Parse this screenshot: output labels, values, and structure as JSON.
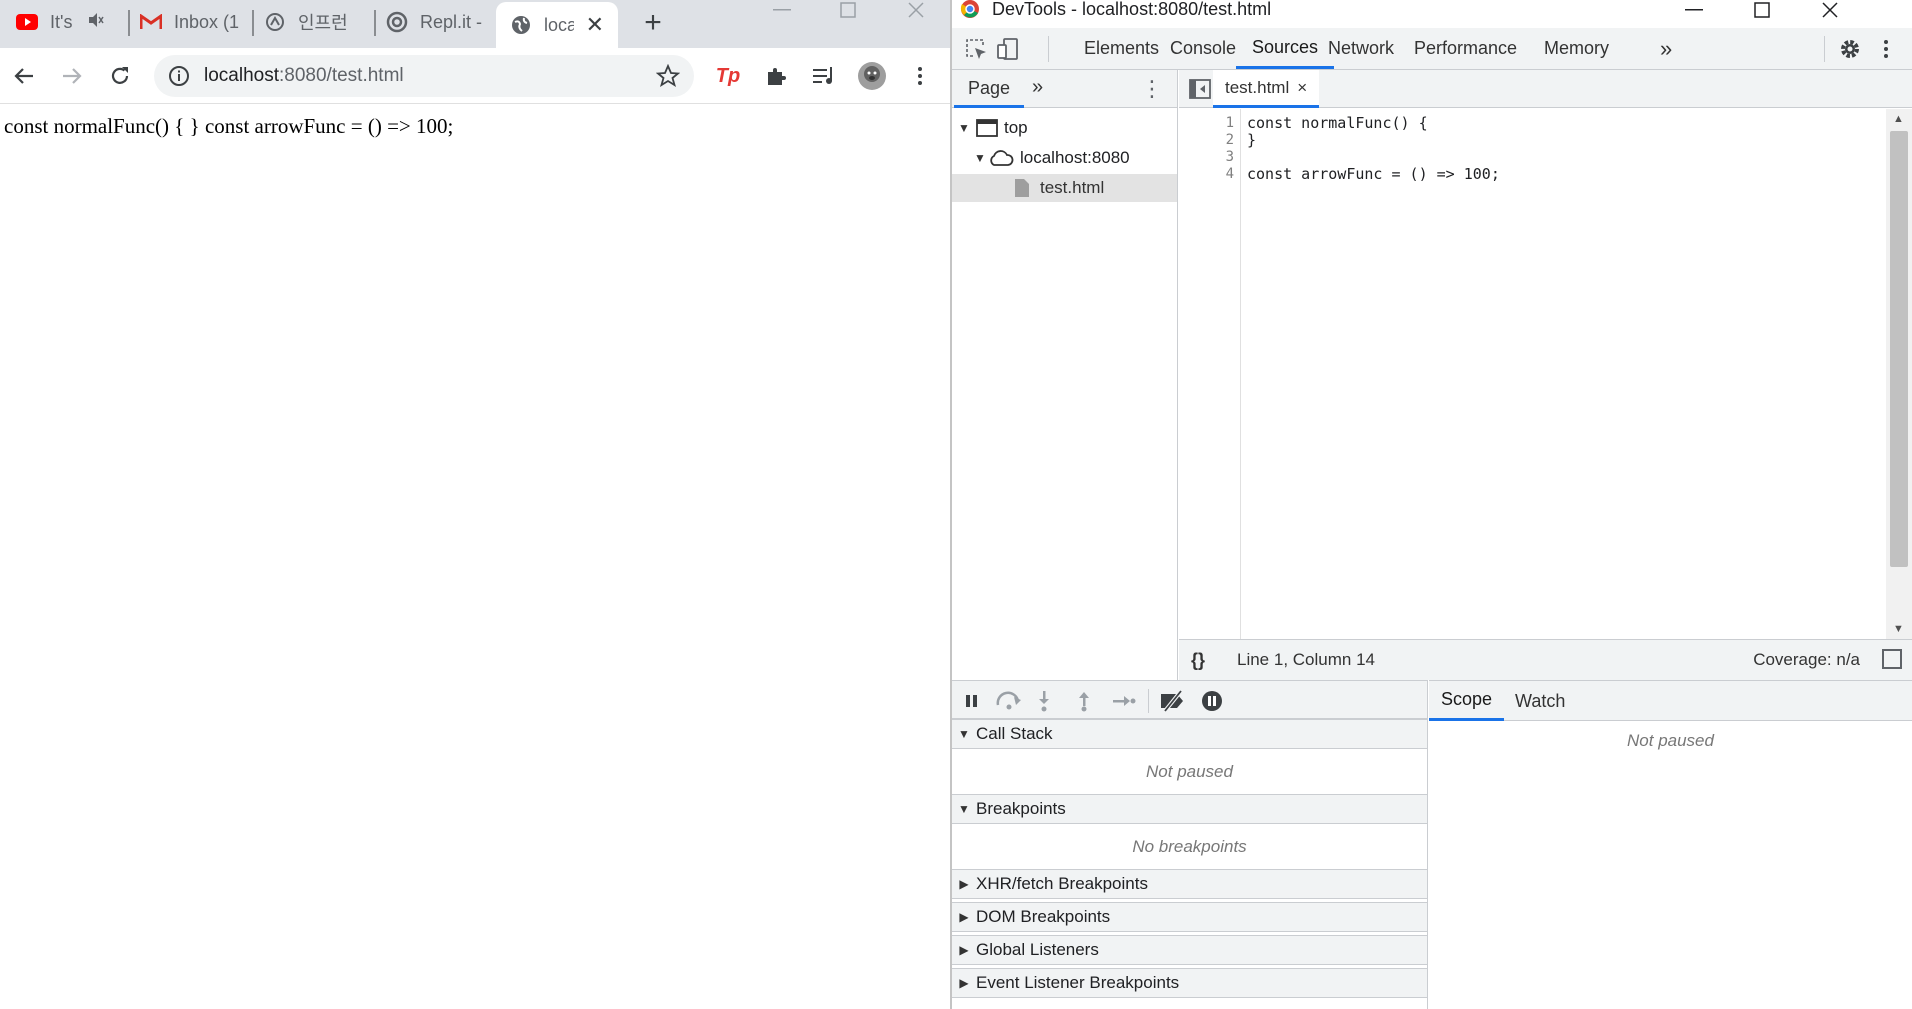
{
  "browser": {
    "tabs": [
      {
        "label": "It's r",
        "icon": "youtube-icon"
      },
      {
        "label": "Inbox (1",
        "icon": "gmail-icon"
      },
      {
        "label": "인프런",
        "icon": "inflearn-icon"
      },
      {
        "label": "Repl.it -",
        "icon": "replit-icon"
      },
      {
        "label": "loca",
        "icon": "globe-icon",
        "active": true
      }
    ],
    "new_tab": "+",
    "url_host": "localhost",
    "url_rest": ":8080/test.html",
    "page_text": "const normalFunc() { } const arrowFunc = () => 100;",
    "colors": {
      "youtube": "#ff0000",
      "tp": "#e53935",
      "accent": "#1a73e8"
    }
  },
  "devtools": {
    "window_title": "DevTools - localhost:8080/test.html",
    "tabs": [
      "Elements",
      "Console",
      "Sources",
      "Network",
      "Performance",
      "Memory"
    ],
    "active_tab": "Sources",
    "more_tabs": "»",
    "navigator": {
      "tab": "Page",
      "more": "»",
      "tree": {
        "top": "top",
        "host": "localhost:8080",
        "file": "test.html"
      }
    },
    "editor": {
      "file_tab": "test.html",
      "close": "×",
      "lines": [
        {
          "n": "1",
          "code": "const normalFunc() {"
        },
        {
          "n": "2",
          "code": "}"
        },
        {
          "n": "3",
          "code": ""
        },
        {
          "n": "4",
          "code": "const arrowFunc = () => 100;"
        }
      ],
      "format_button": "{}",
      "cursor_position": "Line 1, Column 14",
      "coverage": "Coverage: n/a"
    },
    "debugger": {
      "call_stack": "Call Stack",
      "call_stack_empty": "Not paused",
      "breakpoints": "Breakpoints",
      "breakpoints_empty": "No breakpoints",
      "xhr": "XHR/fetch Breakpoints",
      "dom": "DOM Breakpoints",
      "global": "Global Listeners",
      "event": "Event Listener Breakpoints"
    },
    "scope": {
      "tabs": [
        "Scope",
        "Watch"
      ],
      "body": "Not paused"
    }
  }
}
